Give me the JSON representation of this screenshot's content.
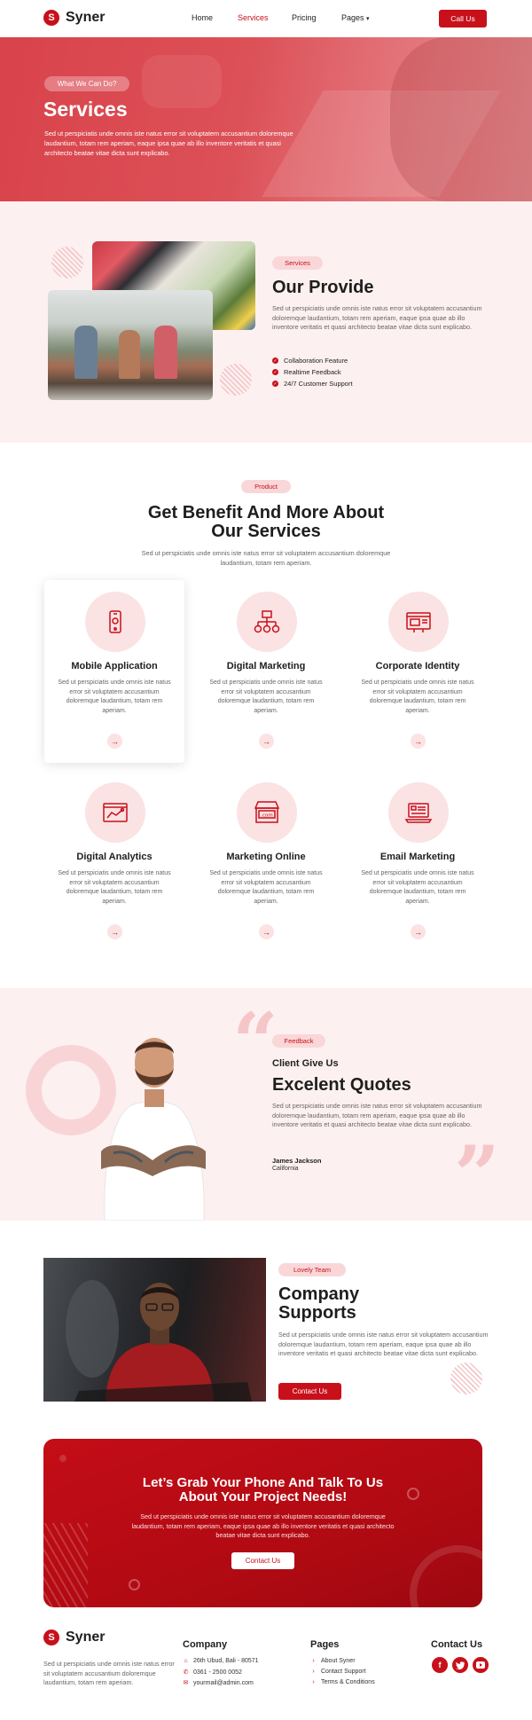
{
  "brand": {
    "name": "Syner",
    "mark": "S"
  },
  "nav": {
    "items": [
      "Home",
      "Services",
      "Pricing",
      "Pages"
    ],
    "pages_caret": "▾",
    "cta": "Call Us"
  },
  "hero": {
    "pill": "What We Can Do?",
    "title": "Services",
    "text": "Sed ut perspiciatis unde omnis iste natus error sit voluptatem accusantium doloremque laudantium, totam rem aperiam, eaque ipsa quae ab illo inventore veritatis et quasi architecto beatae vitae dicta sunt explicabo."
  },
  "provide": {
    "pill": "Services",
    "title": "Our Provide",
    "text": "Sed ut perspiciatis unde omnis iste natus error sit voluptatem accusantium doloremque laudantium, totam rem aperiam, eaque ipsa quae ab illo inventore veritatis et quasi architecto beatae vitae dicta sunt explicabo.",
    "features": [
      "Collaboration Feature",
      "Realtime Feedback",
      "24/7 Customer Support"
    ]
  },
  "services": {
    "pill": "Product",
    "title_line1": "Get Benefit And More About",
    "title_line2": "Our Services",
    "subtitle": "Sed ut perspiciatis unde omnis iste natus error sit voluptatem accusantium doloremque laudantium, totam rem aperiam.",
    "cards": [
      {
        "title": "Mobile Application",
        "icon": "mobile-icon",
        "text": "Sed ut perspiciatis unde omnis iste natus error sit voluptatem accusantium doloremque laudantium, totam rem aperiam."
      },
      {
        "title": "Digital Marketing",
        "icon": "sitemap-icon",
        "text": "Sed ut perspiciatis unde omnis iste natus error sit voluptatem accusantium doloremque laudantium, totam rem aperiam."
      },
      {
        "title": "Corporate Identity",
        "icon": "browser-icon",
        "text": "Sed ut perspiciatis unde omnis iste natus error sit voluptatem accusantium doloremque laudantium, totam rem aperiam."
      },
      {
        "title": "Digital Analytics",
        "icon": "analytics-icon",
        "text": "Sed ut perspiciatis unde omnis iste natus error sit voluptatem accusantium doloremque laudantium, totam rem aperiam."
      },
      {
        "title": "Marketing Online",
        "icon": "store-icon",
        "text": "Sed ut perspiciatis unde omnis iste natus error sit voluptatem accusantium doloremque laudantium, totam rem aperiam."
      },
      {
        "title": "Email Marketing",
        "icon": "laptop-icon",
        "text": "Sed ut perspiciatis unde omnis iste natus error sit voluptatem accusantium doloremque laudantium, totam rem aperiam."
      }
    ],
    "arrow": "→"
  },
  "feedback": {
    "pill": "Feedback",
    "subtitle": "Client Give Us",
    "title": "Excelent Quotes",
    "text": "Sed ut perspiciatis unde omnis iste natus error sit voluptatem accusantium doloremque laudantium, totam rem aperiam, eaque ipsa quae ab illo inventore veritatis et quasi architecto beatae vitae dicta sunt explicabo.",
    "author": "James Jackson",
    "location": "California"
  },
  "team": {
    "pill": "Lovely Team",
    "title_line1": "Company",
    "title_line2": "Supports",
    "text": "Sed ut perspiciatis unde omnis iste natus error sit voluptatem accusantium doloremque laudantium, totam rem aperiam, eaque ipsa quae ab illo inventore veritatis et quasi architecto beatae vitae dicta sunt explicabo.",
    "button": "Contact Us"
  },
  "cta": {
    "title_line1": "Let’s Grab Your Phone And Talk To Us",
    "title_line2": "About Your Project Needs!",
    "text": "Sed ut perspiciatis unde omnis iste natus error sit voluptatem accusantium doloremque laudantium, totam rem aperiam, eaque ipsa quae ab illo inventore veritatis et quasi architecto beatae vitae dicta sunt explicabo.",
    "button": "Contact Us"
  },
  "footer": {
    "about": "Sed ut perspiciatis unde omnis iste natus error sit voluptatem accusantium doloremque laudantium, totam rem aperiam.",
    "company": {
      "heading": "Company",
      "address": "26th Ubud, Bali - 80571",
      "phone": "0361 - 2500 0052",
      "email": "yourmail@admin.com"
    },
    "pages": {
      "heading": "Pages",
      "links": [
        "About Syner",
        "Contact Support",
        "Terms & Conditions"
      ]
    },
    "contact": {
      "heading": "Contact Us",
      "social": [
        "facebook-icon",
        "twitter-icon",
        "youtube-icon"
      ]
    }
  },
  "colors": {
    "accent": "#c8101b",
    "soft_pink": "#fdf0f0",
    "pill_pink": "#f9d7d8"
  }
}
